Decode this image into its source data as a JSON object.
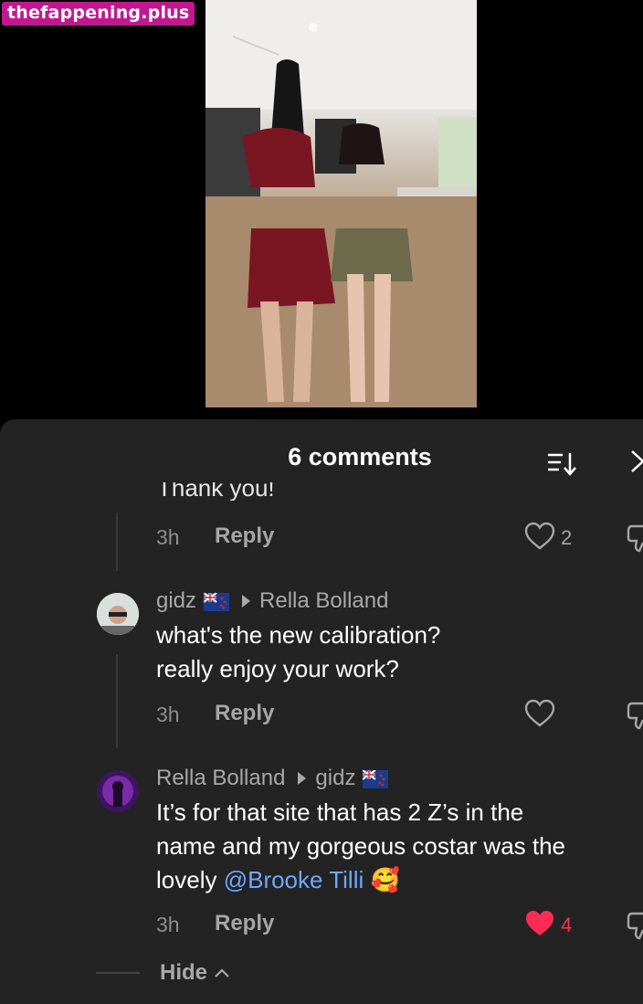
{
  "watermark": "thefappening.plus",
  "comments_panel": {
    "title": "6 comments"
  },
  "thread": {
    "cut_text": "Thank you!",
    "first_meta": {
      "time": "3h",
      "reply_label": "Reply",
      "likes": "2"
    },
    "comments": [
      {
        "author": "gidz",
        "reply_to": "Rella Bolland",
        "lines": [
          "what's the new calibration?",
          "really enjoy your work?"
        ],
        "time": "3h",
        "reply_label": "Reply",
        "likes": "",
        "liked": false
      },
      {
        "author": "Rella Bolland",
        "reply_to": "gidz",
        "lines": [
          "It’s for that site that has 2 Z’s in the",
          "name and my gorgeous costar was the"
        ],
        "last_line_text": "lovely ",
        "mention": "@Brooke Tilli",
        "emoji": "🥰",
        "time": "3h",
        "reply_label": "Reply",
        "likes": "4",
        "liked": true
      }
    ]
  },
  "hide_label": "Hide",
  "colors": {
    "panel": "#232323",
    "mention": "#6ea8ff",
    "like_active": "#fe2c55",
    "watermark": "#c0188f"
  }
}
